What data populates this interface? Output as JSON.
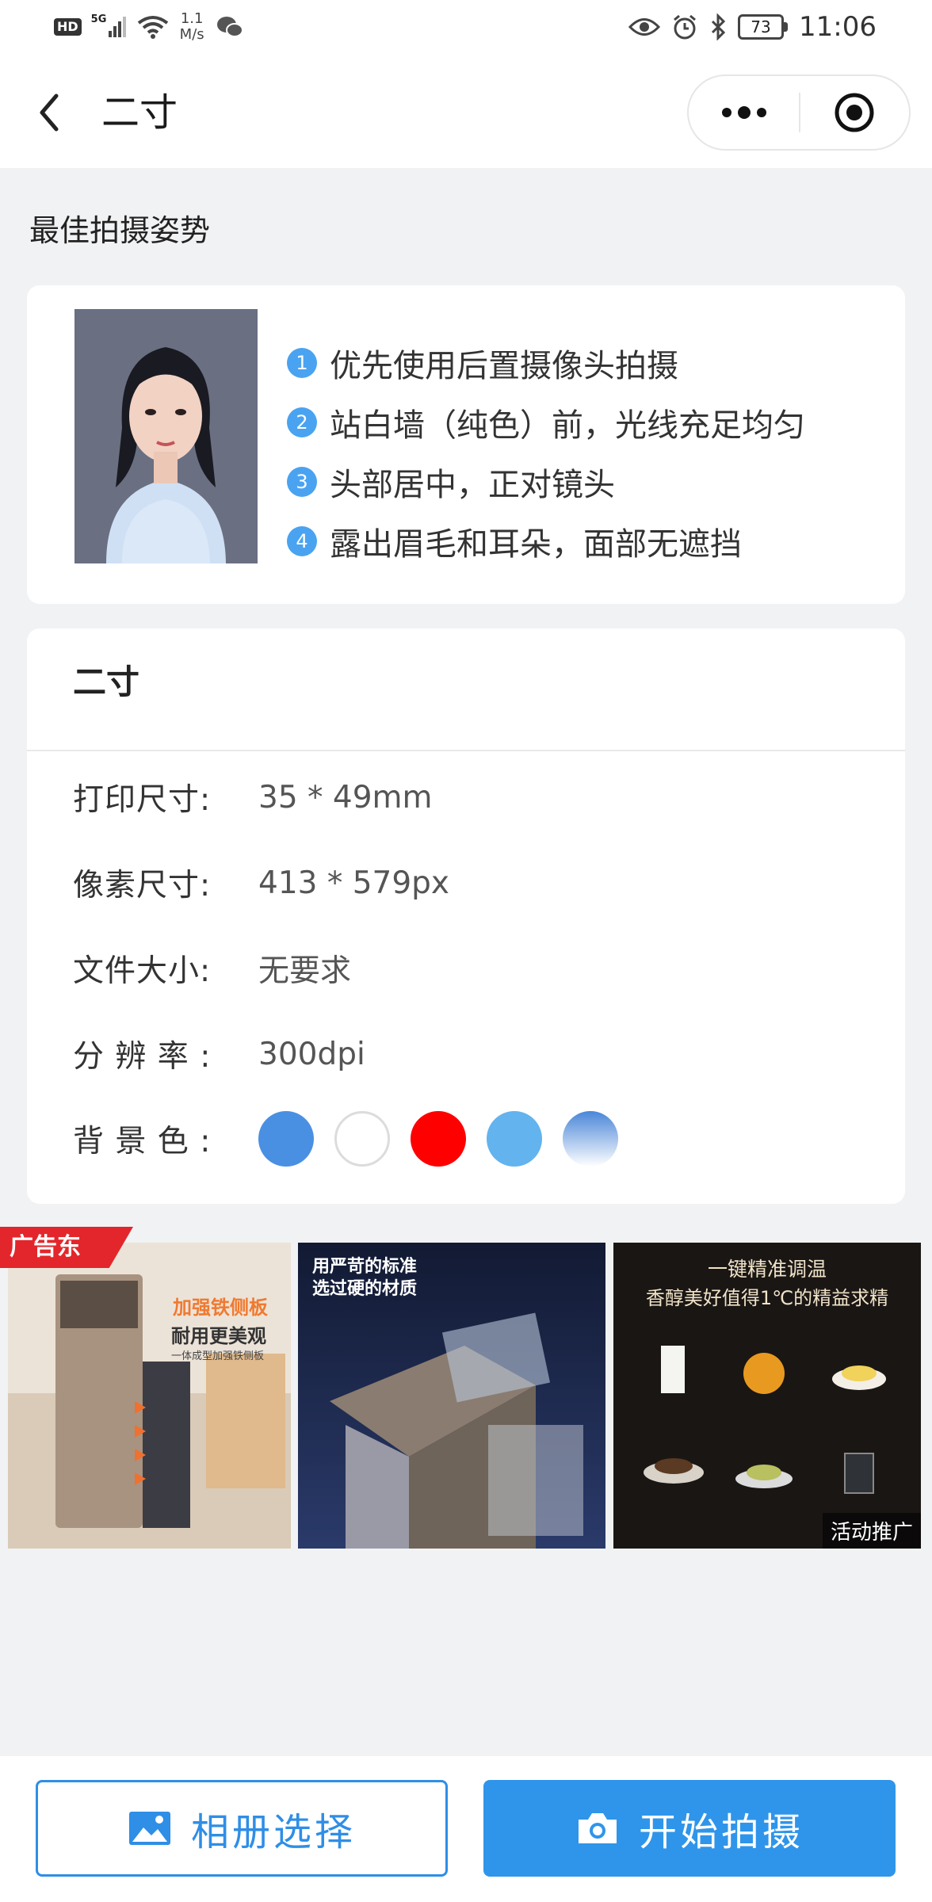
{
  "status_bar": {
    "hd_badge": "HD",
    "network": "5G",
    "speed_value": "1.1",
    "speed_unit": "M/s",
    "battery": "73",
    "time": "11:06"
  },
  "header": {
    "title": "二寸"
  },
  "tips": {
    "heading": "最佳拍摄姿势",
    "items": [
      {
        "num": "1",
        "text": "优先使用后置摄像头拍摄"
      },
      {
        "num": "2",
        "text": "站白墙（纯色）前，光线充足均匀"
      },
      {
        "num": "3",
        "text": "头部居中，正对镜头"
      },
      {
        "num": "4",
        "text": "露出眉毛和耳朵，面部无遮挡"
      }
    ]
  },
  "spec": {
    "title": "二寸",
    "rows": [
      {
        "key": "打印尺寸:",
        "value": "35 * 49mm"
      },
      {
        "key": "像素尺寸:",
        "value": "413 * 579px"
      },
      {
        "key": "文件大小:",
        "value": "无要求"
      },
      {
        "key": "分 辨 率 :",
        "value": "300dpi"
      }
    ],
    "bg_label": "背 景 色 :",
    "bg_colors": [
      "#4a90e2",
      "#ffffff",
      "#ff0000",
      "#63b3ee",
      "gradient-blue"
    ]
  },
  "ads": {
    "badge": "广告东",
    "ad1": {
      "headline": "加强铁侧板",
      "sub": "耐用更美观",
      "caption": "一体成型加强铁侧板"
    },
    "ad2": {
      "headline": "用严苛的标准",
      "sub": "选过硬的材质"
    },
    "ad3": {
      "headline": "一键精准调温",
      "sub": "香醇美好值得1℃的精益求精",
      "tag": "活动推广"
    }
  },
  "bottom": {
    "album_label": "相册选择",
    "shoot_label": "开始拍摄"
  }
}
